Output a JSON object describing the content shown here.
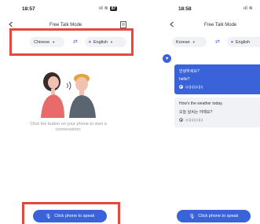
{
  "left": {
    "status": {
      "time": "18:57",
      "signal": "ııl",
      "wifi": "≋",
      "battery": "87"
    },
    "nav": {
      "title": "Free Talk Mode"
    },
    "languages": {
      "source": "Chinese",
      "target": "English"
    },
    "hint": "Click the button on your phone to start a conversation.",
    "speak_button": "Click phone to speak"
  },
  "right": {
    "status": {
      "time": "18:58",
      "signal": "ııl",
      "wifi": "≋"
    },
    "nav": {
      "title": "Free Talk Mode"
    },
    "languages": {
      "source": "Korean",
      "target": "English"
    },
    "messages": [
      {
        "original": "안녕하세요?",
        "translation": "hello?",
        "wave": "ı|ı||ı||ı|ı||ı|"
      },
      {
        "original": "How's the weather today.",
        "translation": "오늘 날씨는 어때요?",
        "wave": "ı|ı||ı||ı|ı||ı|"
      }
    ],
    "speak_button": "Click phone to speak"
  },
  "colors": {
    "accent": "#3a63d9",
    "highlight_frame": "#e34a3d",
    "pill_bg": "#f0f2f5"
  },
  "icons": {
    "back": "chevron-left-icon",
    "doc": "document-edit-icon",
    "swap": "swap-arrows-icon",
    "target_lang": "heart-icon",
    "mic": "microphone-icon",
    "play": "play-circle-icon"
  }
}
